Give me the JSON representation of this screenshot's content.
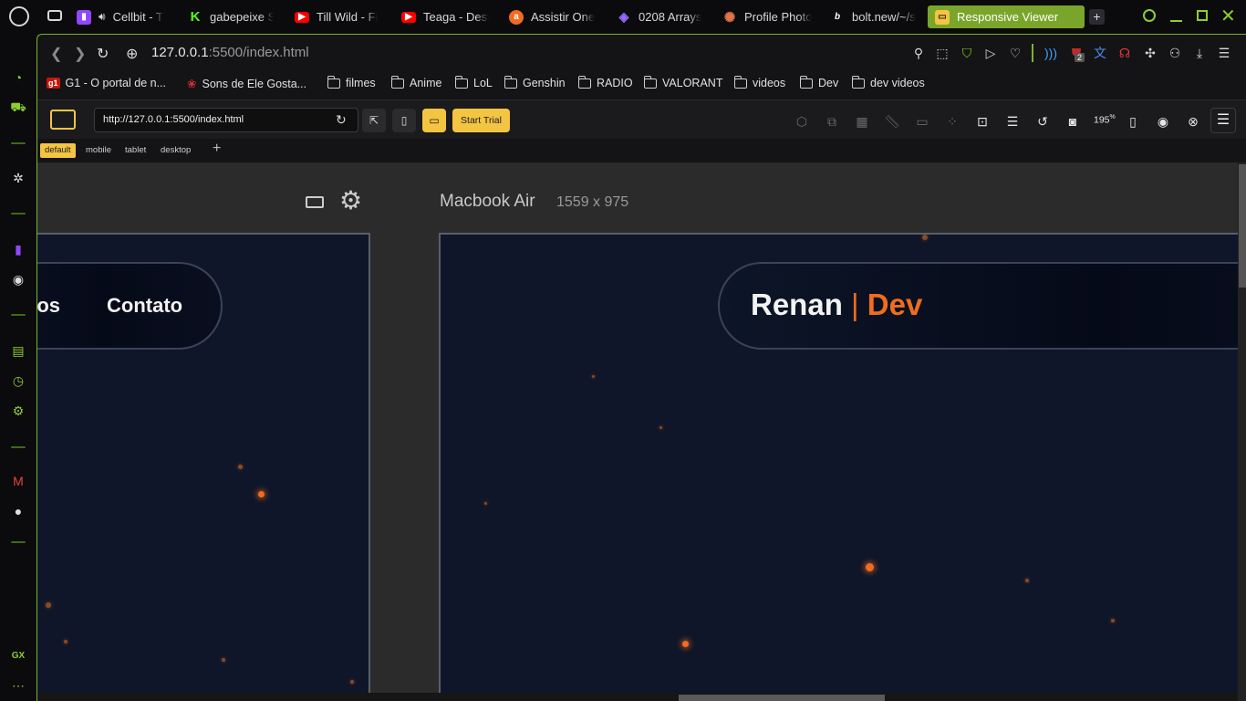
{
  "tabs": [
    {
      "label": "Cellbit - T",
      "icon": "twitch-icon",
      "color": "#9146ff",
      "muted_icon": "speaker-icon"
    },
    {
      "label": "gabepeixe S",
      "icon": "kick-icon",
      "color": "#53fc18"
    },
    {
      "label": "Till Wild - Fi",
      "icon": "youtube-icon",
      "color": "#ff0000"
    },
    {
      "label": "Teaga - Dest",
      "icon": "youtube-icon",
      "color": "#ff0000"
    },
    {
      "label": "Assistir One",
      "icon": "anime-site-icon",
      "color": "#f06c1e"
    },
    {
      "label": "0208 Arrays",
      "icon": "owl-icon",
      "color": "#9b6bff"
    },
    {
      "label": "Profile Photo",
      "icon": "starburst-icon",
      "color": "#e0734a"
    },
    {
      "label": "bolt.new/~/s",
      "icon": "bolt-icon",
      "color": "#ffffff"
    },
    {
      "label": "Responsive Viewer",
      "icon": "responsive-viewer-icon",
      "color": "#f4c542",
      "active": true
    }
  ],
  "address": {
    "host": "127.0.0.1",
    "port_path": ":5500/index.html"
  },
  "toolbar_icons": [
    "pin-icon",
    "snapshot-icon",
    "shield-icon",
    "play-icon",
    "heart-icon",
    "wireless-icon",
    "ublock-icon",
    "translate-icon",
    "headphones-icon",
    "extensions-icon",
    "account-icon",
    "download-icon",
    "easy-setup-icon"
  ],
  "ublock_badge": "2",
  "bookmarks": [
    {
      "label": "G1 - O portal de n...",
      "type": "site",
      "icon": "g1-icon"
    },
    {
      "label": "Sons de Ele Gosta...",
      "type": "site",
      "icon": "rose-icon"
    },
    {
      "label": "filmes",
      "type": "folder"
    },
    {
      "label": "Anime",
      "type": "folder"
    },
    {
      "label": "LoL",
      "type": "folder"
    },
    {
      "label": "Genshin",
      "type": "folder"
    },
    {
      "label": "RADIO",
      "type": "folder"
    },
    {
      "label": "VALORANT",
      "type": "folder"
    },
    {
      "label": "videos",
      "type": "folder"
    },
    {
      "label": "Dev",
      "type": "folder"
    },
    {
      "label": "dev videos",
      "type": "folder"
    }
  ],
  "rv": {
    "url": "http://127.0.0.1:5500/index.html",
    "start_trial": "Start Trial",
    "zoom": "195",
    "zoom_sup": "%",
    "device_tabs": [
      "default",
      "mobile",
      "tablet",
      "desktop"
    ],
    "add_tab": "+"
  },
  "devices": {
    "left": {
      "nav_links": [
        "tos",
        "Contato"
      ]
    },
    "right": {
      "name": "Macbook Air",
      "size": "1559 x 975",
      "brand_first": "Renan",
      "brand_sep": "|",
      "brand_second": "Dev"
    }
  },
  "colors": {
    "accent_green": "#78b52d",
    "rv_yellow": "#f4c542",
    "brand_orange": "#f06c1e",
    "site_bg": "#0f1629"
  }
}
